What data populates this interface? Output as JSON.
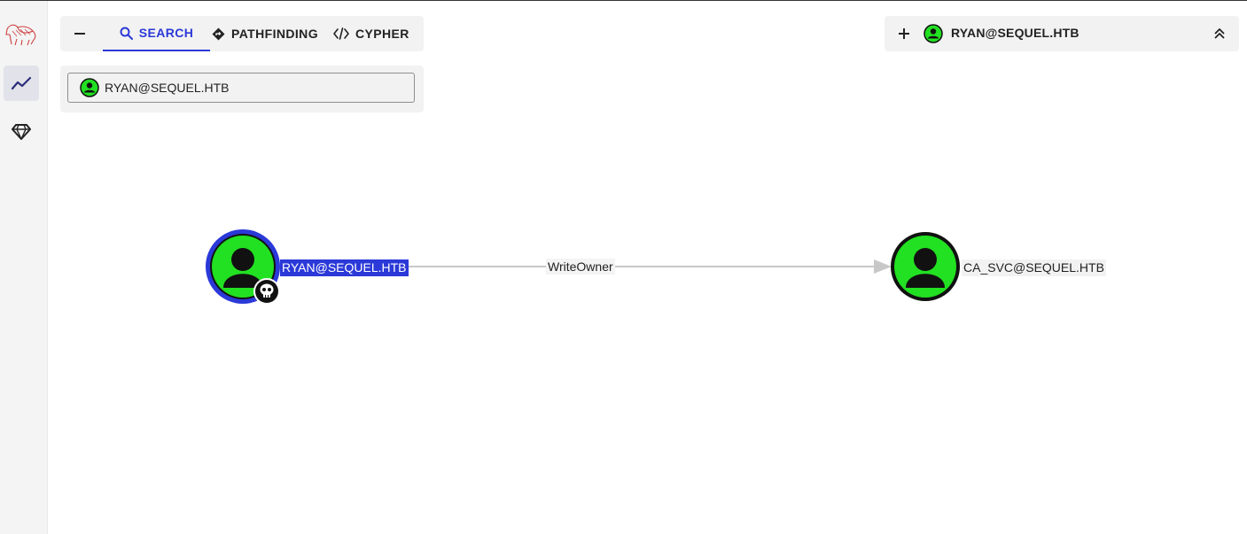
{
  "tabs": {
    "search": "SEARCH",
    "pathfinding": "PATHFINDING",
    "cypher": "CYPHER"
  },
  "search": {
    "value": "RYAN@SEQUEL.HTB"
  },
  "selected_node": {
    "title": "RYAN@SEQUEL.HTB"
  },
  "graph": {
    "source_node": "RYAN@SEQUEL.HTB",
    "target_node": "CA_SVC@SEQUEL.HTB",
    "edge_label": "WriteOwner"
  },
  "colors": {
    "accent": "#2b39d8",
    "user_node": "#22e022",
    "edge": "#c8c8c8"
  },
  "icons": {
    "logo": "bloodhound-logo",
    "explore": "chart-line-icon",
    "gem": "gem-icon",
    "owned": "skull-icon"
  }
}
